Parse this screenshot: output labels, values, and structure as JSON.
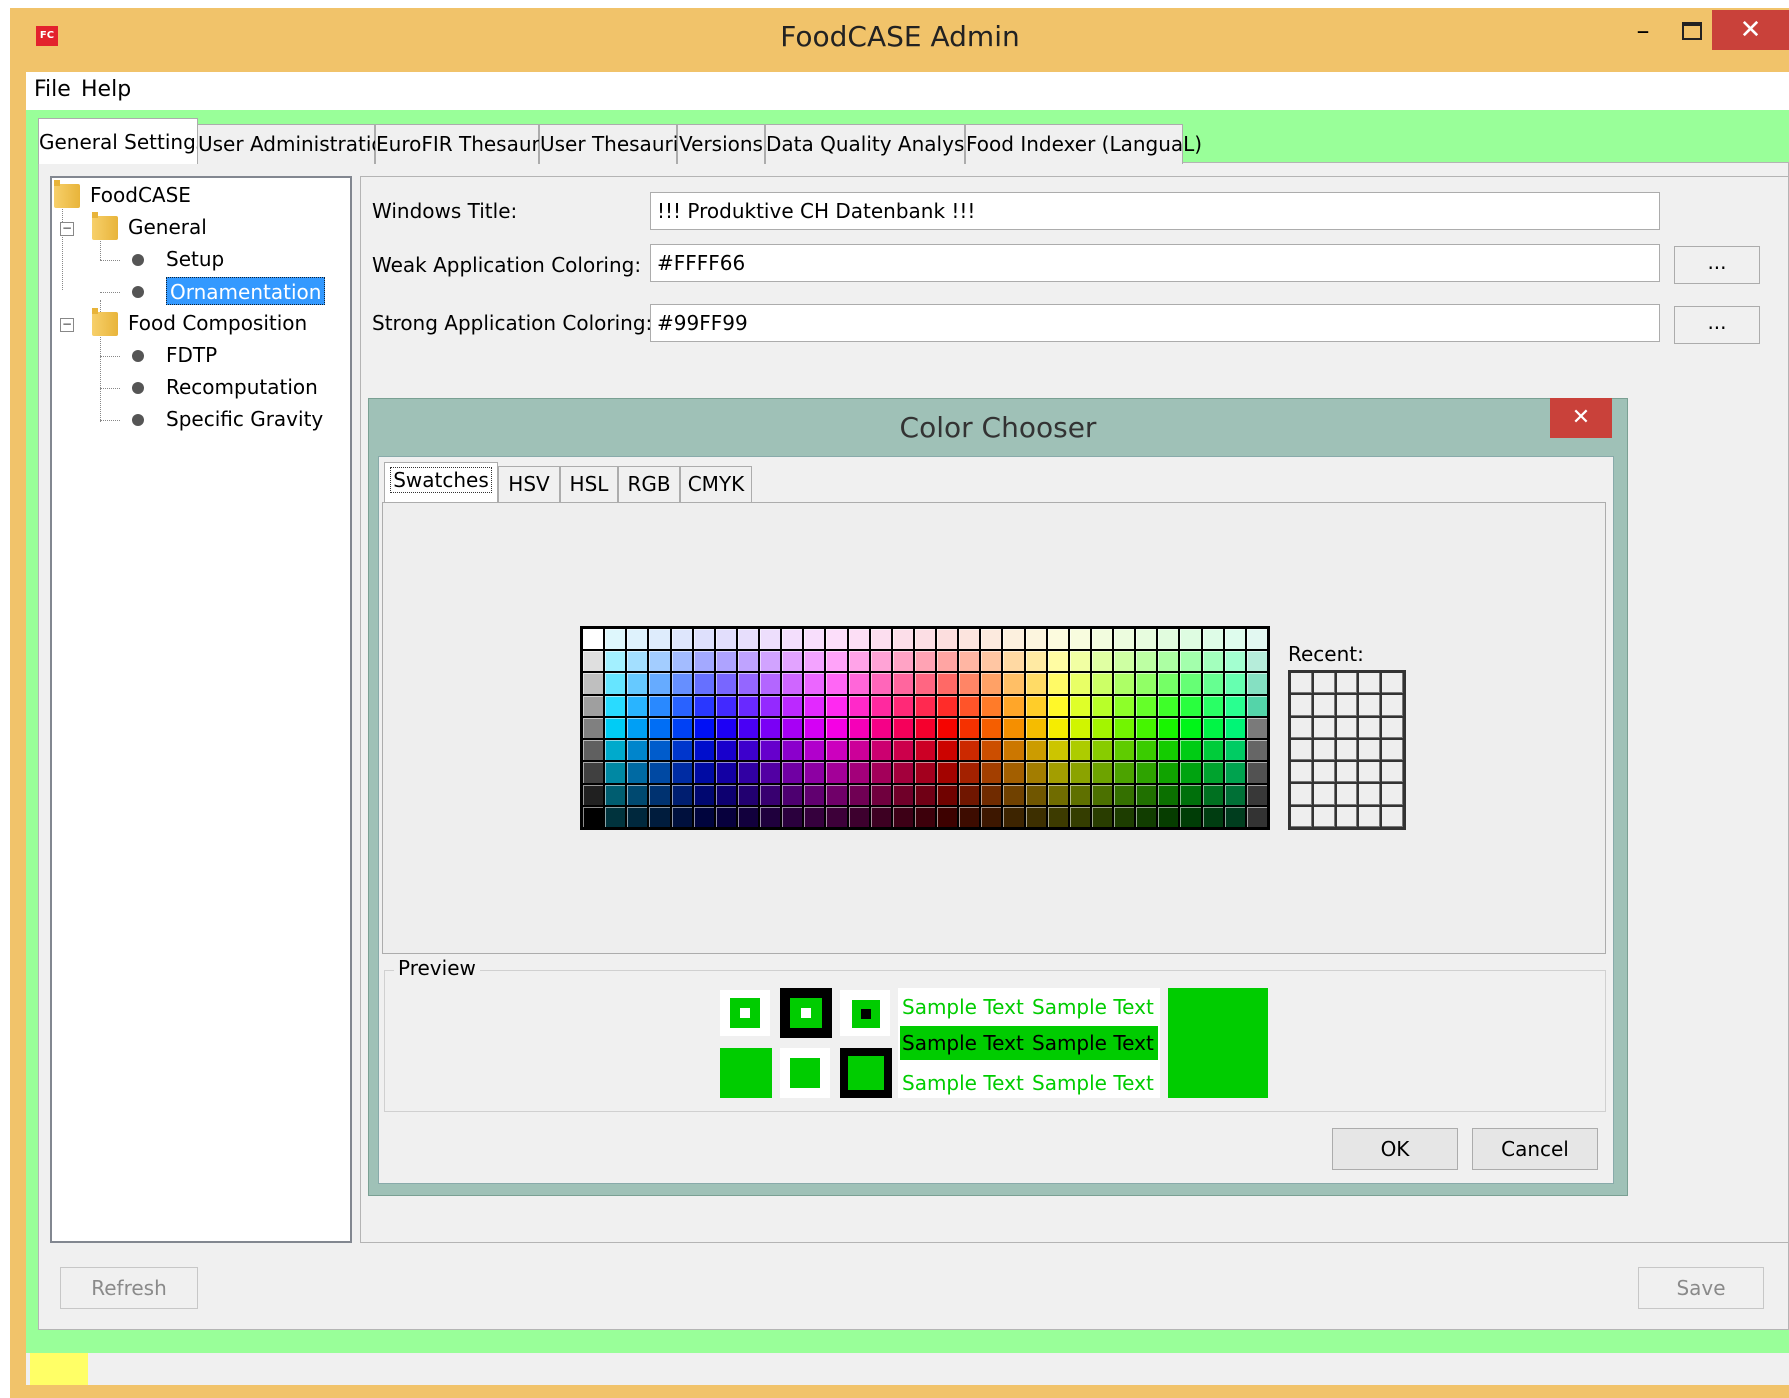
{
  "window": {
    "title": "FoodCASE Admin",
    "icon_text": "FC",
    "minimize": "–",
    "close": "✕"
  },
  "menu": [
    "File",
    "Help"
  ],
  "tabs": [
    {
      "label": "General Settings",
      "active": true
    },
    {
      "label": "User Administration",
      "active": false
    },
    {
      "label": "EuroFIR Thesauri",
      "active": false
    },
    {
      "label": "User Thesauri",
      "active": false
    },
    {
      "label": "Versions",
      "active": false
    },
    {
      "label": "Data Quality Analysis",
      "active": false
    },
    {
      "label": "Food Indexer (LanguaL)",
      "active": false
    }
  ],
  "tree": {
    "root": "FoodCASE",
    "general": "General",
    "setup": "Setup",
    "ornamentation": "Ornamentation",
    "food_composition": "Food Composition",
    "fdtp": "FDTP",
    "recomputation": "Recomputation",
    "specific_gravity": "Specific Gravity",
    "selected": "Ornamentation"
  },
  "form": {
    "windows_title_label": "Windows Title:",
    "windows_title_value": "!!! Produktive CH Datenbank !!!",
    "weak_label": "Weak Application Coloring:",
    "weak_value": "#FFFF66",
    "strong_label": "Strong Application Coloring:",
    "strong_value": "#99FF99",
    "browse_label": "..."
  },
  "dialog": {
    "title": "Color Chooser",
    "close": "✕",
    "tabs": [
      "Swatches",
      "HSV",
      "HSL",
      "RGB",
      "CMYK"
    ],
    "active_tab": "Swatches",
    "recent_label": "Recent:",
    "preview_label": "Preview",
    "sample_text": "Sample Text",
    "ok": "OK",
    "cancel": "Cancel",
    "preview_color": "#00cc00"
  },
  "bottom": {
    "refresh": "Refresh",
    "save": "Save"
  },
  "colors": {
    "weak": "#FFFF66",
    "strong": "#99FF99",
    "titlebar": "#f1c36a",
    "dialog_frame": "#9fc1b7"
  }
}
